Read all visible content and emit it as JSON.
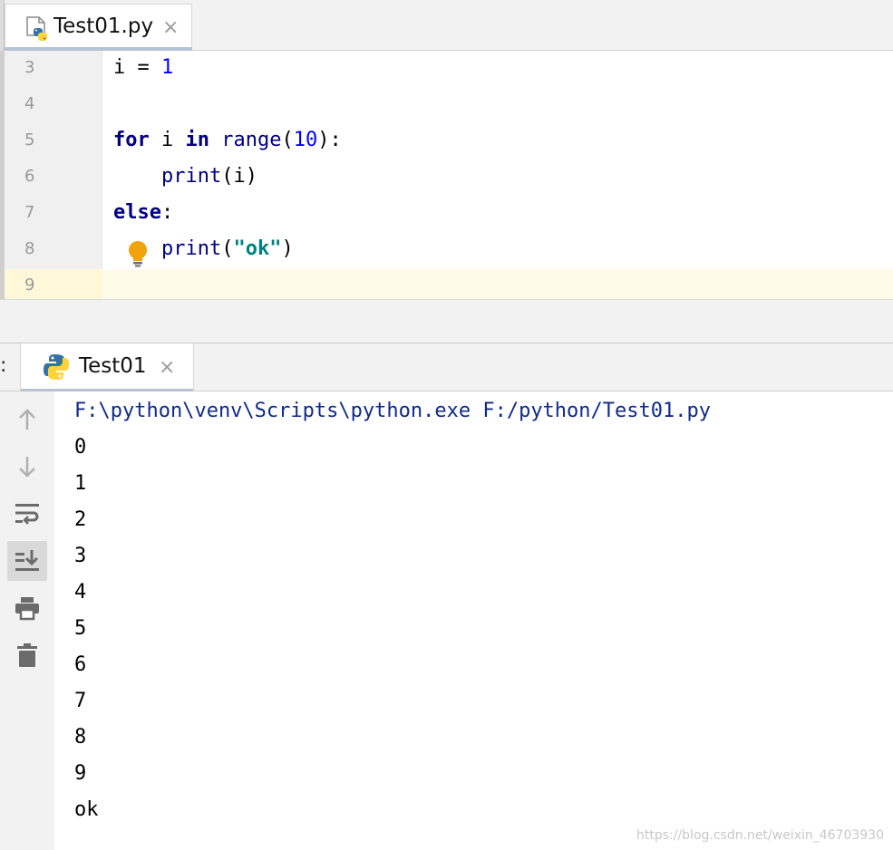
{
  "editor": {
    "tab": {
      "label": "Test01.py",
      "close": "×"
    },
    "lines": [
      {
        "no": "3",
        "tokens": [
          [
            "plain",
            "i = "
          ],
          [
            "num",
            "1"
          ]
        ]
      },
      {
        "no": "4",
        "tokens": []
      },
      {
        "no": "5",
        "tokens": [
          [
            "kw",
            "for"
          ],
          [
            "plain",
            " i "
          ],
          [
            "kw",
            "in"
          ],
          [
            "plain",
            " "
          ],
          [
            "builtin",
            "range"
          ],
          [
            "plain",
            "("
          ],
          [
            "num",
            "10"
          ],
          [
            "plain",
            "):"
          ]
        ]
      },
      {
        "no": "6",
        "tokens": [
          [
            "plain",
            "    "
          ],
          [
            "builtin",
            "print"
          ],
          [
            "plain",
            "(i)"
          ]
        ]
      },
      {
        "no": "7",
        "tokens": [
          [
            "kw",
            "else"
          ],
          [
            "plain",
            ":"
          ]
        ]
      },
      {
        "no": "8",
        "tokens": [
          [
            "plain",
            "    "
          ],
          [
            "builtin",
            "print"
          ],
          [
            "plain",
            "("
          ],
          [
            "str",
            "\"ok\""
          ],
          [
            "plain",
            ")"
          ]
        ]
      },
      {
        "no": "9",
        "tokens": []
      }
    ]
  },
  "run": {
    "left_label": ":",
    "tab": {
      "label": "Test01",
      "close": "×"
    },
    "output": [
      {
        "text": "F:\\python\\venv\\Scripts\\python.exe F:/python/Test01.py",
        "kind": "cmd"
      },
      {
        "text": "0",
        "kind": "out"
      },
      {
        "text": "1",
        "kind": "out"
      },
      {
        "text": "2",
        "kind": "out"
      },
      {
        "text": "3",
        "kind": "out"
      },
      {
        "text": "4",
        "kind": "out"
      },
      {
        "text": "5",
        "kind": "out"
      },
      {
        "text": "6",
        "kind": "out"
      },
      {
        "text": "7",
        "kind": "out"
      },
      {
        "text": "8",
        "kind": "out"
      },
      {
        "text": "9",
        "kind": "out"
      },
      {
        "text": "ok",
        "kind": "out"
      }
    ],
    "toolbar_icons": [
      "arrow-up-icon",
      "arrow-down-icon",
      "soft-wrap-icon",
      "scroll-to-end-icon",
      "print-icon",
      "trash-icon"
    ]
  },
  "watermark": "https://blog.csdn.net/weixin_46703930",
  "colors": {
    "keyword": "#000080",
    "number": "#0000ff",
    "string": "#008080",
    "current_line": "#fefbe8",
    "cmd": "#0f2a8a"
  }
}
